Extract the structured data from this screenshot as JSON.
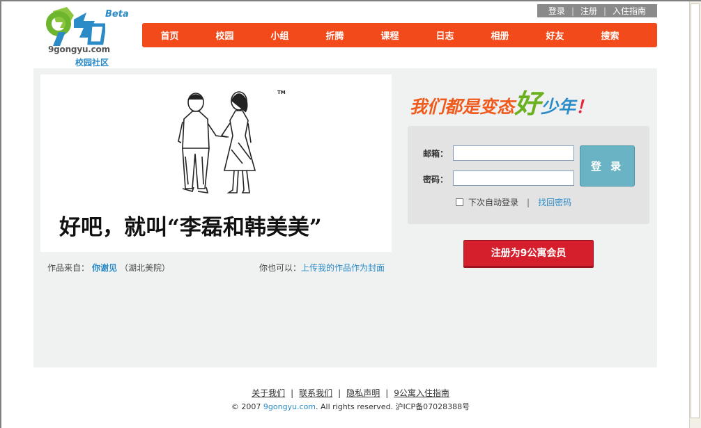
{
  "header": {
    "beta": "Beta",
    "domain": "9gongyu.com",
    "subtitle": "校园社区",
    "toplinks": [
      "登录",
      "注册",
      "入住指南"
    ]
  },
  "nav": [
    "首页",
    "校园",
    "小组",
    "折腾",
    "课程",
    "日志",
    "相册",
    "好友",
    "搜索"
  ],
  "artwork": {
    "caption": "好吧，就叫“李磊和韩美美”",
    "tm": "TM",
    "credit_prefix": "作品来自：",
    "credit_name": "你谢见",
    "credit_school": "（湖北美院）",
    "upload_prefix": "你也可以：",
    "upload_link": "上传我的作品作为封面"
  },
  "slogan": {
    "part1": "我们都是变态",
    "part2": "好",
    "part3": "少年",
    "part4": "！"
  },
  "login": {
    "email_label": "邮箱：",
    "email_value": "",
    "password_label": "密码：",
    "password_value": "",
    "login_button": "登 录",
    "remember_label": "下次自动登录",
    "separator": "|",
    "forgot_link": "找回密码"
  },
  "register_button": "注册为9公寓会员",
  "footer": {
    "links": [
      "关于我们",
      "联系我们",
      "隐私声明",
      "9公寓入住指南"
    ],
    "copyright_prefix": "© 2007 ",
    "copyright_site": "9gongyu.com",
    "copyright_suffix": ". All rights reserved. 沪ICP备07028388号"
  },
  "colors": {
    "nav_bg": "#f24a1a",
    "accent_blue": "#2b8bc6",
    "login_button": "#6ab3c4",
    "register_button": "#d61f2c",
    "panel_bg": "#f0f1f1"
  }
}
